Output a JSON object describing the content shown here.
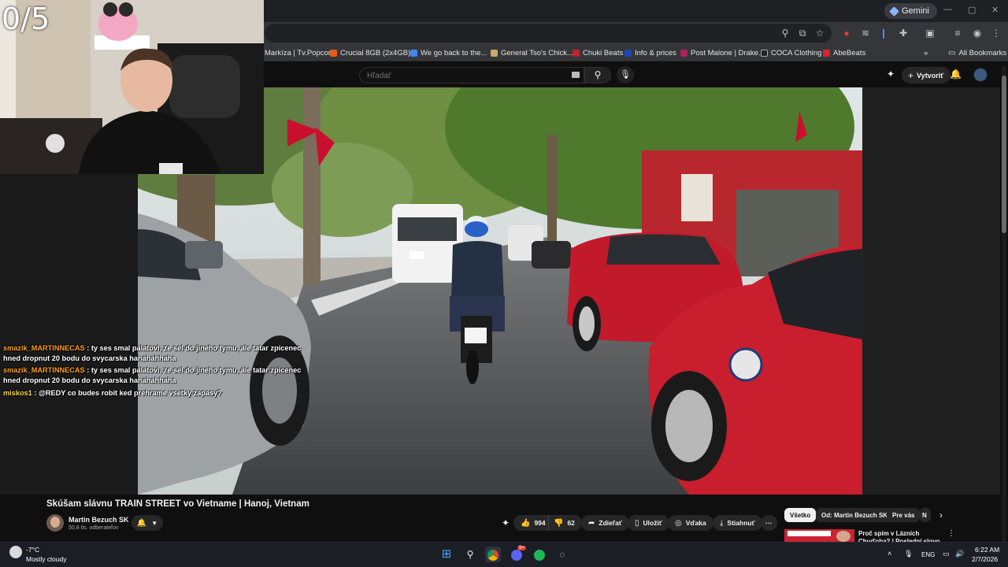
{
  "overlay": {
    "counter": "0/5",
    "chat": [
      {
        "user": "smazik_MARTINNECAS",
        "message": ": ty ses smal palatovi, ze sel do jineho tymu, ale tatar zpicenec",
        "message2": "hned dropnut 20 bodu do svycarska hahahahhaha"
      },
      {
        "user": "smazik_MARTINNECAS",
        "message": ": ty ses smal palatovi, ze sel do jineho tymu, ale tatar zpicenec",
        "message2": "hned dropnut 20 bodu do svycarska hahahahhaha"
      },
      {
        "user": "miskos1",
        "message": ": @REDY co budes robit ked prehrame vsetky zapasy?"
      }
    ]
  },
  "browser": {
    "gemini_label": "Gemini",
    "bookmarks": [
      {
        "label": "Markíza | Tv.Popcor...",
        "color": "#000000"
      },
      {
        "label": "Crucial 8GB (2x4GB)...",
        "color": "#e35b1f"
      },
      {
        "label": "We go back to the...",
        "color": "#4285f4"
      },
      {
        "label": "General Tso's Chick...",
        "color": "#c9a86a"
      },
      {
        "label": "Chuki Beats",
        "color": "#c0212b"
      },
      {
        "label": "Info & prices",
        "color": "#1a47b8"
      },
      {
        "label": "Post Malone | Drake...",
        "color": "#b21f5a"
      },
      {
        "label": "COCA Clothing",
        "color": "#222222"
      },
      {
        "label": "AbeBeats",
        "color": "#d8232a"
      }
    ],
    "all_bookmarks": "All Bookmarks"
  },
  "youtube": {
    "search_placeholder": "Hľadať",
    "create_label": "Vytvoriť",
    "video_title": "Skúšam slávnu TRAIN STREET vo Vietname | Hanoj, Vietnam",
    "channel_name": "Martin Bezuch SK",
    "subscribers": "50,8 tis. odberateľov",
    "likes": "994",
    "dislikes": "62",
    "share": "Zdieľať",
    "save": "Uložiť",
    "thanks": "Vďaka",
    "download": "Stiahnuť",
    "more": "···",
    "chips": [
      "Všetko",
      "Od: Martin Bezuch SK",
      "Pre vás",
      "N"
    ],
    "rec_title": "Proč spím v Lázních Chuďoba? | Poslední slovo"
  },
  "taskbar": {
    "temperature": "-7°C",
    "weather": "Mostly cloudy",
    "language": "ENG",
    "time": "6:22 AM",
    "date": "2/7/2026",
    "discord_badge": "9+"
  },
  "colors": {
    "accent_red": "#c8102e",
    "chat_user": "#ff9f1a"
  }
}
